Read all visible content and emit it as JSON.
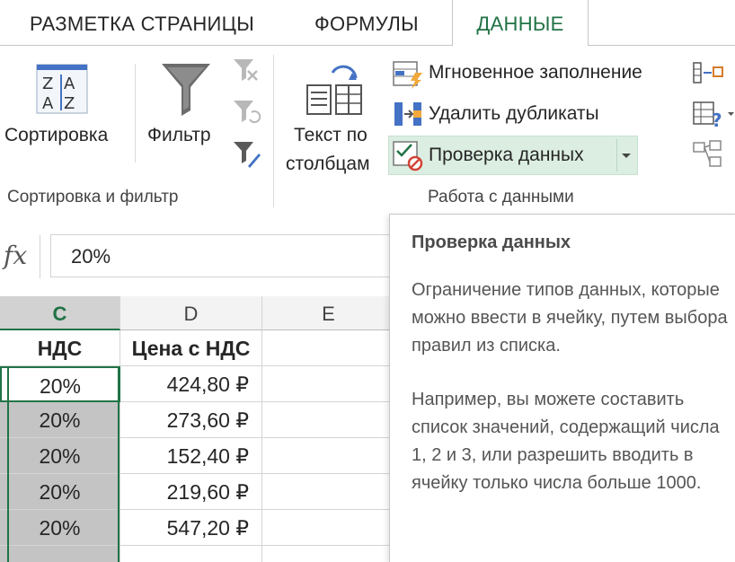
{
  "tabs": [
    {
      "label": "РАЗМЕТКА СТРАНИЦЫ"
    },
    {
      "label": "ФОРМУЛЫ"
    },
    {
      "label": "ДАННЫЕ",
      "active": true
    }
  ],
  "ribbon": {
    "sort_label": "Сортировка",
    "filter_label": "Фильтр",
    "text_to_columns_line1": "Текст по",
    "text_to_columns_line2": "столбцам",
    "flash_fill_label": "Мгновенное заполнение",
    "remove_duplicates_label": "Удалить дубликаты",
    "data_validation_label": "Проверка данных",
    "group_sort_filter": "Сортировка и фильтр",
    "group_data_tools": "Работа с данными"
  },
  "formula_bar": {
    "fx_label": "fx",
    "value": "20%"
  },
  "grid": {
    "columns": [
      "C",
      "D",
      "E"
    ],
    "header_row": {
      "c": "НДС",
      "d": "Цена с НДС"
    },
    "rows": [
      {
        "c": "20%",
        "d": "424,80 ₽"
      },
      {
        "c": "20%",
        "d": "273,60 ₽"
      },
      {
        "c": "20%",
        "d": "152,40 ₽"
      },
      {
        "c": "20%",
        "d": "219,60 ₽"
      },
      {
        "c": "20%",
        "d": "547,20 ₽"
      }
    ]
  },
  "tooltip": {
    "title": "Проверка данных",
    "paragraph1": "Ограничение типов данных, которые можно ввести в ячейку, путем выбора правил из списка.",
    "paragraph2": "Например, вы можете составить список значений, содержащий числа 1, 2 и 3, или разрешить вводить в ячейку только числа больше 1000."
  },
  "colors": {
    "accent": "#217346",
    "selected_fill": "#c4c4c4"
  }
}
